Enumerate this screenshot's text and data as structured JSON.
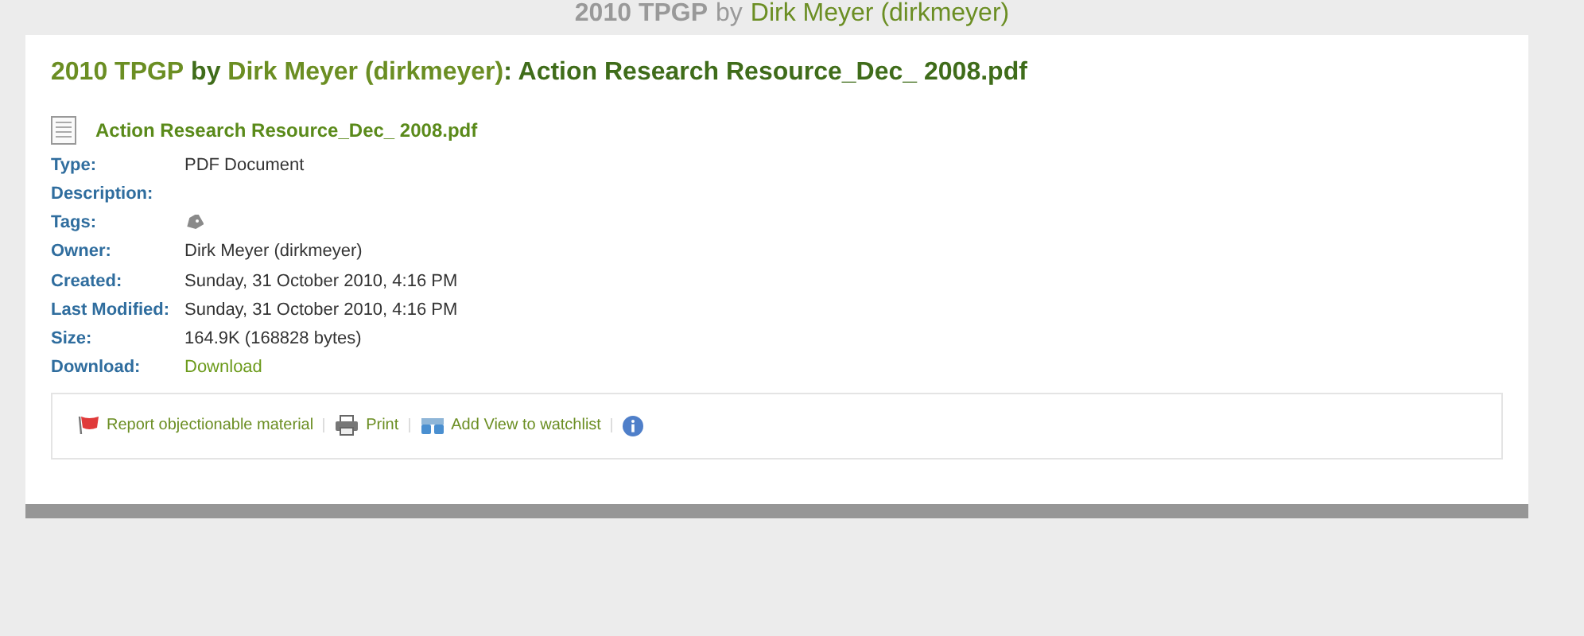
{
  "page_header": {
    "group": "2010 TPGP",
    "by": "by",
    "owner": "Dirk Meyer (dirkmeyer)"
  },
  "heading": {
    "group": "2010 TPGP",
    "by": "by",
    "owner": "Dirk Meyer (dirkmeyer)",
    "title": ": Action Research Resource_Dec_ 2008.pdf"
  },
  "file": {
    "name": "Action Research Resource_Dec_ 2008.pdf"
  },
  "fields": [
    {
      "label": "Type:",
      "kind": "text",
      "value": "PDF Document"
    },
    {
      "label": "Description:",
      "kind": "text"
    },
    {
      "label": "Tags:",
      "kind": "tags"
    },
    {
      "label": "Owner:",
      "kind": "text",
      "value": "Dirk Meyer (dirkmeyer)"
    },
    {
      "label": "Created:",
      "kind": "text",
      "value": "Sunday, 31 October 2010, 4:16 PM"
    },
    {
      "label": "Last Modified:",
      "kind": "text",
      "value": "Sunday, 31 October 2010, 4:16 PM"
    },
    {
      "label": "Size:",
      "kind": "text",
      "value": "164.9K (168828 bytes)"
    },
    {
      "label": "Download:",
      "kind": "link",
      "value": "Download"
    }
  ],
  "actions": [
    {
      "kind": "flag",
      "label": "Report objectionable material"
    },
    {
      "kind": "print",
      "label": "Print"
    },
    {
      "kind": "watch",
      "label": "Add View to watchlist"
    },
    {
      "kind": "info"
    }
  ]
}
